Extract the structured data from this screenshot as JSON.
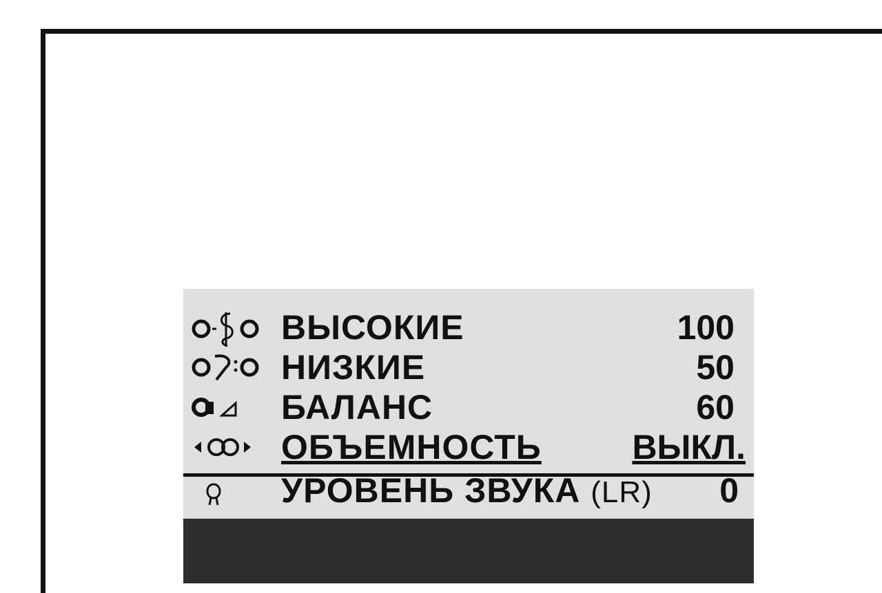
{
  "menu": {
    "rows": [
      {
        "label": "ВЫСОКИЕ",
        "value": "100",
        "icon": "treble-icon"
      },
      {
        "label": "НИЗКИЕ",
        "value": "50",
        "icon": "bass-icon"
      },
      {
        "label": "БАЛАНС",
        "value": "60",
        "icon": "balance-icon"
      },
      {
        "label": "ОБЪЕМНОСТЬ",
        "value": "ВЫКЛ.",
        "icon": "surround-icon"
      },
      {
        "label": "УРОВЕНЬ ЗВУКА",
        "badge": "(LR)",
        "value": "0",
        "icon": "sound-level-icon"
      }
    ]
  },
  "colors": {
    "osd_background": "#e0e0e0",
    "osd_dark_band": "#2e2e2e",
    "text": "#111111"
  }
}
